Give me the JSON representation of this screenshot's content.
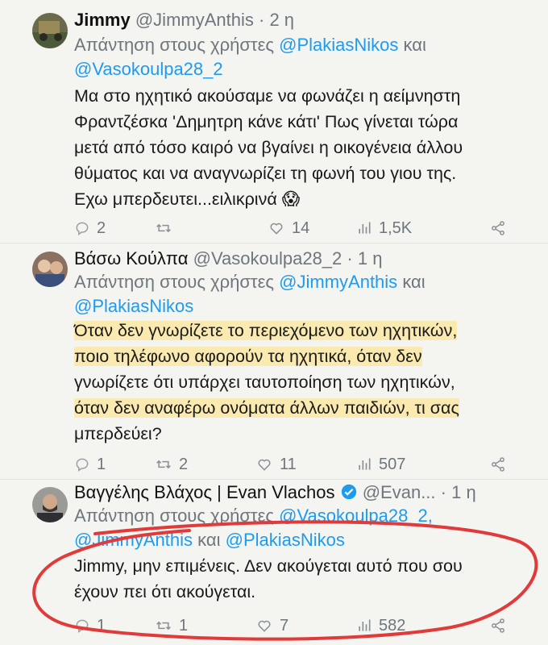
{
  "tweets": [
    {
      "name": "Jimmy",
      "handle": "@JimmyAnthis",
      "dot": "·",
      "time": "2 η",
      "reply_prefix": "Απάντηση στους χρήστες",
      "reply_mention_1": "@PlakiasNikos",
      "reply_and": "και",
      "reply_mention_2": "@Vasokoulpa28_2",
      "body": [
        "Μα στο ηχητικό ακούσαμε να φωνάζει η αείμνηστη",
        "Φραντζέσκα 'Δημητρη κάνε κάτι' Πως γίνεται τώρα",
        "μετά από τόσο καιρό να βγαίνει η οικογένεια άλλου",
        "θύματος και να αναγνωρίζει τη φωνή του γιου της.",
        "Εχω μπερδευτει...ειλικρινά 😱"
      ],
      "replies": "2",
      "retweets": "",
      "likes": "14",
      "views": "1,5K"
    },
    {
      "name": "Βάσω Κούλπα",
      "handle": "@Vasokoulpa28_2",
      "dot": "·",
      "time": "1 η",
      "reply_prefix": "Απάντηση στους χρήστες",
      "reply_mention_1": "@JimmyAnthis",
      "reply_and": "και",
      "reply_mention_2": "@PlakiasNikos",
      "body": [
        "Όταν δεν γνωρίζετε το περιεχόμενο των ηχητικών,",
        "ποιο τηλέφωνο αφορούν τα ηχητικά, όταν δεν",
        "γνωρίζετε ότι υπάρχει ταυτοποίηση των ηχητικών,",
        "όταν δεν αναφέρω ονόματα άλλων παιδιών, τι σας",
        "μπερδεύει?"
      ],
      "replies": "1",
      "retweets": "2",
      "likes": "11",
      "views": "507"
    },
    {
      "name": "Βαγγέλης Βλάχος | Evan Vlachos",
      "handle": "@Evan...",
      "dot": "·",
      "time": "1 η",
      "reply_prefix": "Απάντηση στους χρήστες",
      "reply_mention_1": "@Vasokoulpa28_2,",
      "reply_mention_2": "@JimmyAnthis",
      "reply_and": "και",
      "reply_mention_3": "@PlakiasNikos",
      "body": [
        "Jimmy, μην επιμένεις. Δεν ακούγεται αυτό που σου",
        "έχουν πει ότι ακούγεται."
      ],
      "replies": "1",
      "retweets": "1",
      "likes": "7",
      "views": "582"
    }
  ],
  "colors": {
    "background": "#f4f4f1",
    "mention": "#1d9bf0",
    "verified": "#1d9bf0",
    "muted": "#6e767d",
    "annotation_red": "#e03a3a",
    "highlight": "#ffe278"
  }
}
